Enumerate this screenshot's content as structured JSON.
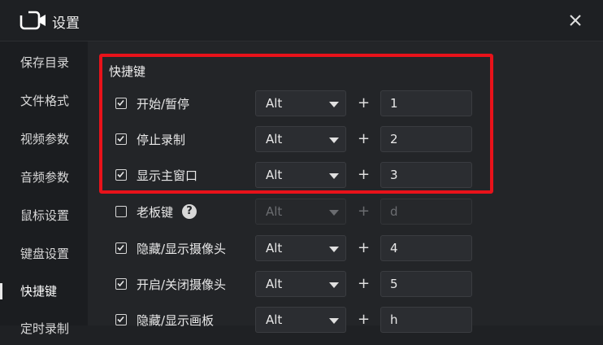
{
  "window": {
    "title": "设置",
    "close_icon": "close-icon",
    "app_icon": "video-camera-icon"
  },
  "sidebar": {
    "items": [
      {
        "label": "保存目录",
        "active": false
      },
      {
        "label": "文件格式",
        "active": false
      },
      {
        "label": "视频参数",
        "active": false
      },
      {
        "label": "音频参数",
        "active": false
      },
      {
        "label": "鼠标设置",
        "active": false
      },
      {
        "label": "键盘设置",
        "active": false
      },
      {
        "label": "快捷键",
        "active": true
      },
      {
        "label": "定时录制",
        "active": false
      }
    ]
  },
  "main": {
    "section_title": "快捷键",
    "rows": [
      {
        "label": "开始/暂停",
        "checked": true,
        "modifier": "Alt",
        "key": "1",
        "disabled": false
      },
      {
        "label": "停止录制",
        "checked": true,
        "modifier": "Alt",
        "key": "2",
        "disabled": false
      },
      {
        "label": "显示主窗口",
        "checked": true,
        "modifier": "Alt",
        "key": "3",
        "disabled": false
      },
      {
        "label": "老板键",
        "checked": false,
        "modifier": "Alt",
        "key": "d",
        "disabled": true,
        "help_icon": "?"
      },
      {
        "label": "隐藏/显示摄像头",
        "checked": true,
        "modifier": "Alt",
        "key": "4",
        "disabled": false
      },
      {
        "label": "开启/关闭摄像头",
        "checked": true,
        "modifier": "Alt",
        "key": "5",
        "disabled": false
      },
      {
        "label": "隐藏/显示画板",
        "checked": true,
        "modifier": "Alt",
        "key": "h",
        "disabled": false
      }
    ],
    "plus_sign": "+"
  },
  "colors": {
    "highlight": "#e8121a",
    "background": "#232528",
    "sidebar": "#1b1d20"
  }
}
